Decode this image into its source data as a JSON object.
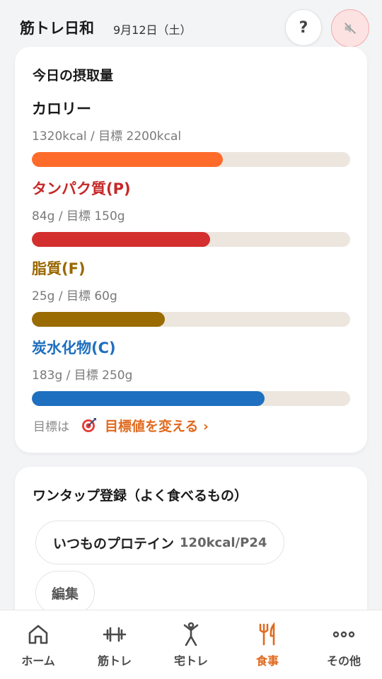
{
  "header": {
    "app_title": "筋トレ日和",
    "date": "9月12日（土）",
    "help_label": "?"
  },
  "intake": {
    "title": "今日の摂取量",
    "nutrients": [
      {
        "label": "カロリー",
        "value_text": "1320kcal / 目標 2200kcal",
        "current": 1320,
        "target": 2200,
        "label_color": "#1a1a1a",
        "bar_color": "#ff6b2b"
      },
      {
        "label": "タンパク質(P)",
        "value_text": "84g / 目標 150g",
        "current": 84,
        "target": 150,
        "label_color": "#c62828",
        "bar_color": "#d32f2f"
      },
      {
        "label": "脂質(F)",
        "value_text": "25g / 目標 60g",
        "current": 25,
        "target": 60,
        "label_color": "#9a6700",
        "bar_color": "#9a6b00"
      },
      {
        "label": "炭水化物(C)",
        "value_text": "183g / 目標 250g",
        "current": 183,
        "target": 250,
        "label_color": "#1e6fbf",
        "bar_color": "#1e6fbf"
      }
    ],
    "goal_prefix": "目標は",
    "goal_link": "目標値を変える ›"
  },
  "onetap": {
    "title": "ワンタップ登録（よく食べるもの）",
    "chips": [
      {
        "name": "いつものプロテイン",
        "meta": "120kcal/P24"
      }
    ],
    "edit_label": "編集"
  },
  "nav": {
    "active": 3,
    "items": [
      {
        "label": "ホーム",
        "icon": "home-icon"
      },
      {
        "label": "筋トレ",
        "icon": "dumbbell-icon"
      },
      {
        "label": "宅トレ",
        "icon": "person-icon"
      },
      {
        "label": "食事",
        "icon": "fork-knife-icon"
      },
      {
        "label": "その他",
        "icon": "more-icon"
      }
    ]
  },
  "colors": {
    "accent": "#e06a1f",
    "bar_track": "#ece6df",
    "mute_bg": "#fde2e2"
  }
}
